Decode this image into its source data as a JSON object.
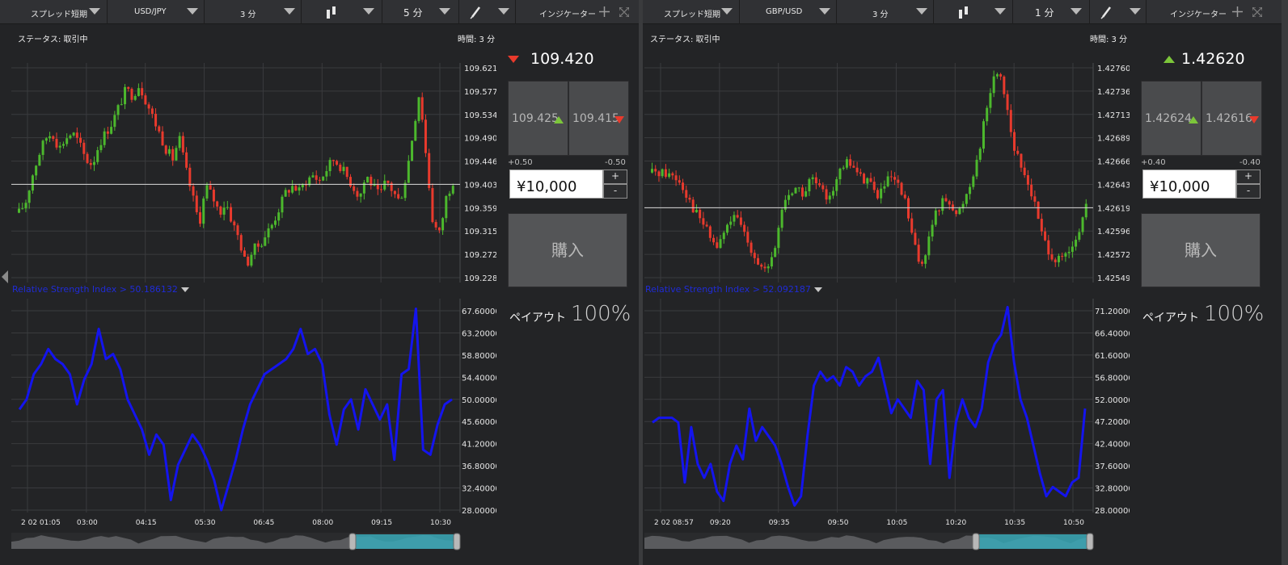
{
  "panels": [
    {
      "toolbar": {
        "strategy": "スプレッド短期",
        "pair": "USD/JPY",
        "expiry": "3 分",
        "timeframe": "5 分",
        "indicators": "インジケーター"
      },
      "status": "ステータス: 取引中",
      "time": "時間: 3 分",
      "price": "109.420",
      "price_direction": "down",
      "high_quote": "109.425",
      "low_quote": "109.415",
      "spread_plus": "+0.50",
      "spread_minus": "-0.50",
      "amount": "¥10,000",
      "plus_label": "+",
      "minus_label": "-",
      "buy_label": "購入",
      "payout_label": "ペイアウト",
      "payout_value": "100%",
      "rsi_legend": "Relative Strength Index > 50.186132",
      "price_axis": [
        "109.6213",
        "109.5777",
        "109.5340",
        "109.4904",
        "109.4467",
        "109.4031",
        "109.3594",
        "109.3158",
        "109.2721",
        "109.2285"
      ],
      "rsi_axis": [
        "67.60000",
        "63.20000",
        "58.80000",
        "54.40000",
        "50.00000",
        "45.60000",
        "41.20000",
        "36.80000",
        "32.40000",
        "28.00000"
      ],
      "time_axis": [
        "2 02 01:05",
        "03:00",
        "04:15",
        "05:30",
        "06:45",
        "08:00",
        "09:15",
        "10:30"
      ],
      "current_price_value": 109.4031,
      "chart_data": {
        "type": "candlestick",
        "ylim": [
          109.2285,
          109.6213
        ],
        "close_path": [
          109.35,
          109.37,
          109.42,
          109.46,
          109.49,
          109.5,
          109.47,
          109.49,
          109.5,
          109.48,
          109.45,
          109.44,
          109.48,
          109.5,
          109.52,
          109.55,
          109.58,
          109.57,
          109.59,
          109.56,
          109.53,
          109.5,
          109.47,
          109.45,
          109.49,
          109.43,
          109.38,
          109.33,
          109.4,
          109.38,
          109.35,
          109.37,
          109.33,
          109.3,
          109.25,
          109.28,
          109.29,
          109.31,
          109.33,
          109.36,
          109.39,
          109.4,
          109.39,
          109.41,
          109.42,
          109.41,
          109.43,
          109.45,
          109.44,
          109.42,
          109.4,
          109.38,
          109.42,
          109.4,
          109.38,
          109.41,
          109.39,
          109.37,
          109.42,
          109.5,
          109.58,
          109.45,
          109.33,
          109.31,
          109.38,
          109.41
        ],
        "rsi_ylim": [
          28,
          67.6
        ],
        "rsi_path": [
          48,
          50,
          55,
          57,
          60,
          58,
          57,
          55,
          49,
          54,
          57,
          64,
          58,
          59,
          56,
          50,
          47,
          44,
          39,
          43,
          41,
          30,
          37,
          40,
          43,
          41,
          38,
          34,
          28,
          33,
          38,
          44,
          49,
          52,
          55,
          56,
          57,
          58,
          60,
          64,
          59,
          60,
          57,
          47,
          41,
          48,
          50,
          44,
          52,
          49,
          46,
          49,
          38,
          55,
          56,
          68,
          40,
          39,
          45,
          49,
          50
        ]
      }
    },
    {
      "toolbar": {
        "strategy": "スプレッド短期",
        "pair": "GBP/USD",
        "expiry": "3 分",
        "timeframe": "1 分",
        "indicators": "インジケーター"
      },
      "status": "ステータス: 取引中",
      "time": "時間: 3 分",
      "price": "1.42620",
      "price_direction": "up",
      "high_quote": "1.42624",
      "low_quote": "1.42616",
      "spread_plus": "+0.40",
      "spread_minus": "-0.40",
      "amount": "¥10,000",
      "plus_label": "+",
      "minus_label": "-",
      "buy_label": "購入",
      "payout_label": "ペイアウト",
      "payout_value": "100%",
      "rsi_legend": "Relative Strength Index > 52.092187",
      "price_axis": [
        "1.427601",
        "1.427367",
        "1.427133",
        "1.426899",
        "1.426665",
        "1.426431",
        "1.426197",
        "1.425963",
        "1.425729",
        "1.425495"
      ],
      "rsi_axis": [
        "71.20000",
        "66.40000",
        "61.60000",
        "56.80000",
        "52.00000",
        "47.20000",
        "42.40000",
        "37.60000",
        "32.80000",
        "28.00000"
      ],
      "time_axis": [
        "2 02 08:57",
        "09:20",
        "09:35",
        "09:50",
        "10:05",
        "10:20",
        "10:35",
        "10:50"
      ],
      "current_price_value": 1.426197,
      "chart_data": {
        "type": "candlestick",
        "ylim": [
          1.425495,
          1.427601
        ],
        "close_path": [
          1.42655,
          1.42656,
          1.42654,
          1.42652,
          1.42645,
          1.4263,
          1.42615,
          1.42605,
          1.4259,
          1.4258,
          1.42595,
          1.4261,
          1.42605,
          1.4259,
          1.42575,
          1.4256,
          1.42555,
          1.4258,
          1.4262,
          1.42635,
          1.4264,
          1.42632,
          1.4265,
          1.4264,
          1.4263,
          1.4264,
          1.42655,
          1.42665,
          1.4266,
          1.42648,
          1.4265,
          1.4263,
          1.4264,
          1.4265,
          1.4264,
          1.42625,
          1.4259,
          1.4256,
          1.4258,
          1.4261,
          1.42625,
          1.4263,
          1.4261,
          1.42625,
          1.42645,
          1.4267,
          1.4271,
          1.42745,
          1.4276,
          1.42725,
          1.4268,
          1.4266,
          1.42645,
          1.4262,
          1.4259,
          1.42575,
          1.42565,
          1.4257,
          1.42575,
          1.42595,
          1.4262
        ],
        "rsi_ylim": [
          28,
          71.2
        ],
        "rsi_path": [
          47,
          48,
          48,
          48,
          47,
          34,
          46,
          38,
          35,
          38,
          32,
          30,
          38,
          42,
          39,
          50,
          43,
          46,
          44,
          42,
          38,
          33,
          29,
          31,
          44,
          55,
          58,
          56,
          57,
          55,
          59,
          58,
          55,
          57,
          58,
          61,
          55,
          49,
          52,
          50,
          48,
          56,
          54,
          38,
          52,
          54,
          35,
          47,
          52,
          48,
          46,
          50,
          60,
          64,
          66,
          72,
          60,
          52,
          48,
          42,
          36,
          31,
          33,
          32,
          31,
          34,
          35,
          50
        ]
      }
    }
  ]
}
